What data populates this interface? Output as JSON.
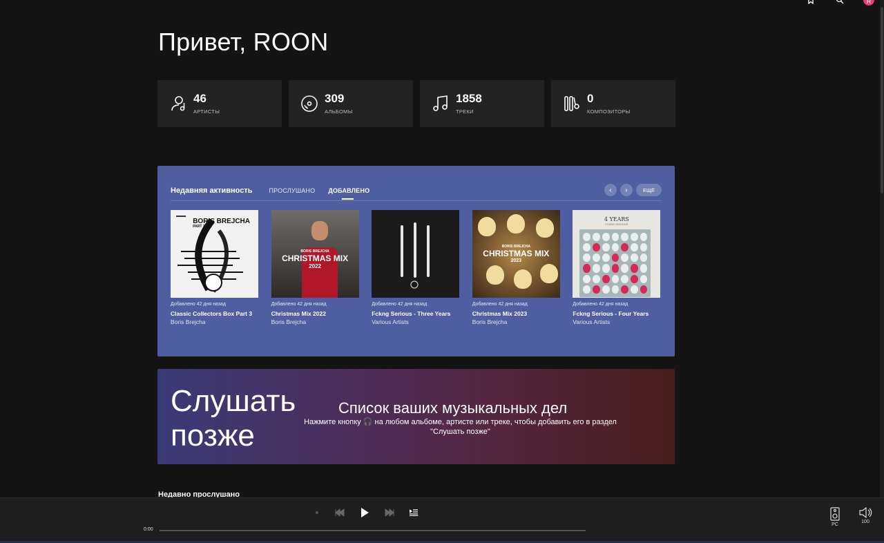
{
  "greeting": "Привет, ROON",
  "top_bar": {
    "avatar_letter": "R"
  },
  "stats": [
    {
      "value": "46",
      "label": "АРТИСТЫ",
      "icon": "artist-icon"
    },
    {
      "value": "309",
      "label": "АЛЬБОМЫ",
      "icon": "album-icon"
    },
    {
      "value": "1858",
      "label": "ТРЕКИ",
      "icon": "track-icon"
    },
    {
      "value": "0",
      "label": "КОМПОЗИТОРЫ",
      "icon": "composer-icon"
    }
  ],
  "activity": {
    "title": "Недавняя активность",
    "tabs": [
      "ПРОСЛУШАНО",
      "ДОБАВЛЕНО"
    ],
    "active_tab": "ДОБАВЛЕНО",
    "more_label": "ЕЩЁ",
    "albums": [
      {
        "added": "Добавлено 42 дня назад",
        "title": "Classic Collectors Box Part 3",
        "artist": "Boris Brejcha",
        "cover_text": "BORIS BREJCHA",
        "cover_sub": "PART 3"
      },
      {
        "added": "Добавлено 42 дня назад",
        "title": "Christmas Mix 2022",
        "artist": "Boris Brejcha",
        "cover_text": "CHRISTMAS MIX",
        "cover_sub": "2022",
        "cover_top": "BORIS BREJCHA"
      },
      {
        "added": "Добавлено 42 дня назад",
        "title": "Fckng Serious - Three Years",
        "artist": "Various Artists"
      },
      {
        "added": "Добавлено 42 дня назад",
        "title": "Christmas Mix 2023",
        "artist": "Boris Brejcha",
        "cover_text": "CHRISTMAS MIX",
        "cover_sub": "2023",
        "cover_top": "BORIS BREJCHA"
      },
      {
        "added": "Добавлено 42 дня назад",
        "title": "Fckng Serious - Four Years",
        "artist": "Various Artists",
        "cover_text": "4 YEARS",
        "cover_sub": "FCKNG SERIOUS"
      }
    ]
  },
  "listen_later": {
    "big_title": "Слушать позже",
    "heading": "Список ваших музыкальных дел",
    "text_before": "Нажмите кнопку",
    "text_after": "на любом альбоме, артисте или треке, чтобы добавить его в раздел \"Слушать позже\""
  },
  "recent_heading": "Недавно прослушано",
  "player": {
    "time": "0:00",
    "progress": 0,
    "zone_label": "PC",
    "volume": "100"
  },
  "colors": {
    "activity_bg": "#4f5ea0",
    "accent_pink": "#e0407a"
  }
}
